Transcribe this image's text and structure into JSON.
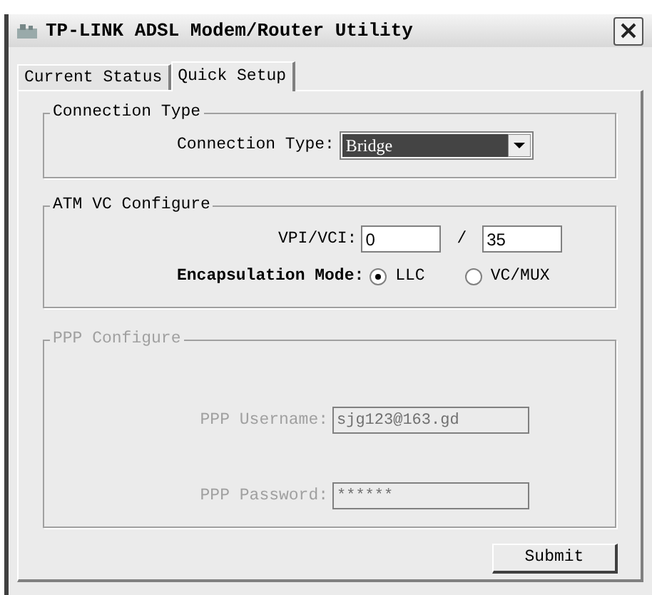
{
  "window": {
    "title": "TP-LINK ADSL Modem/Router Utility"
  },
  "tabs": [
    {
      "label": "Current Status",
      "selected": false
    },
    {
      "label": "Quick Setup",
      "selected": true
    }
  ],
  "connection_type": {
    "title": "Connection Type",
    "label": "Connection Type:",
    "value": "Bridge"
  },
  "atm_vc": {
    "title": "ATM VC Configure",
    "vpi_vci": {
      "label": "VPI/VCI:",
      "vpi": "0",
      "separator": "/",
      "vci": "35"
    },
    "encapsulation": {
      "label": "Encapsulation Mode:",
      "options": [
        {
          "label": "LLC",
          "selected": true
        },
        {
          "label": "VC/MUX",
          "selected": false
        }
      ]
    }
  },
  "ppp": {
    "title": "PPP Configure",
    "disabled": true,
    "fields": [
      {
        "label": "PPP Username:",
        "value": "sjg123@163.gd"
      },
      {
        "label": "PPP Password:",
        "value": "******"
      }
    ]
  },
  "buttons": [
    {
      "label": "Submit"
    }
  ]
}
